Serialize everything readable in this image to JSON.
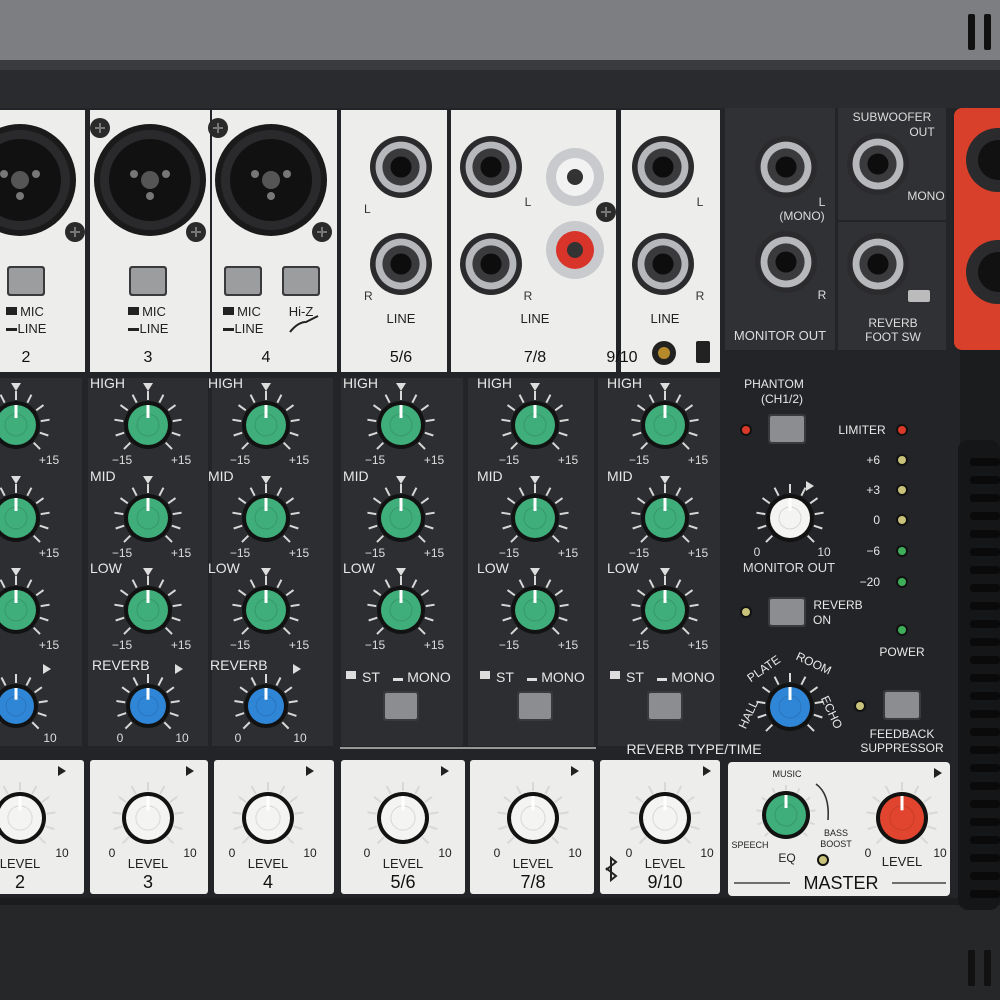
{
  "channels": [
    {
      "id": "ch2",
      "number": "2",
      "input": "combo",
      "switches": [
        "MIC",
        "LINE"
      ],
      "has_hiz": false,
      "reverb_label": "REVERB",
      "scale_min": "0",
      "scale_max": "10"
    },
    {
      "id": "ch3",
      "number": "3",
      "input": "combo",
      "switches": [
        "MIC",
        "LINE"
      ],
      "has_hiz": false,
      "reverb_label": "REVERB",
      "scale_min": "0",
      "scale_max": "10"
    },
    {
      "id": "ch4",
      "number": "4",
      "input": "combo",
      "switches": [
        "MIC",
        "LINE"
      ],
      "has_hiz": true,
      "hiz_label": "Hi-Z",
      "reverb_label": "REVERB",
      "scale_min": "0",
      "scale_max": "10"
    },
    {
      "id": "ch56",
      "number": "5/6",
      "input": "stereo-jack",
      "jack_labels": [
        "L",
        "R"
      ],
      "input_label": "LINE",
      "select": [
        "ST",
        "MONO"
      ]
    },
    {
      "id": "ch78",
      "number": "7/8",
      "input": "stereo-jack-rca",
      "jack_labels": [
        "L",
        "R"
      ],
      "input_label": "LINE",
      "select": [
        "ST",
        "MONO"
      ]
    },
    {
      "id": "ch910",
      "number": "9/10",
      "input": "stereo-jack-mini",
      "jack_labels": [
        "L",
        "R"
      ],
      "input_label": "LINE",
      "select": [
        "ST",
        "MONO"
      ]
    }
  ],
  "eq": {
    "bands": [
      "HIGH",
      "MID",
      "LOW"
    ],
    "scale_min": "−15",
    "scale_max": "+15"
  },
  "level": {
    "label": "LEVEL",
    "scale_min": "0",
    "scale_max": "10"
  },
  "master_section": {
    "monitor_out_label": "MONITOR OUT",
    "mono_label": "(MONO)",
    "jack_l": "L",
    "jack_r": "R",
    "subwoofer_label_line1": "SUBWOOFER",
    "subwoofer_label_line2": "OUT",
    "subwoofer_mono": "MONO",
    "reverb_foot_label_line1": "REVERB",
    "reverb_foot_label_line2": "FOOT SW",
    "phantom_label": "PHANTOM",
    "phantom_sub": "(CH1/2)",
    "monitor_knob_label": "MONITOR OUT",
    "monitor_scale_min": "0",
    "monitor_scale_max": "10",
    "reverb_on_line1": "REVERB",
    "reverb_on_line2": "ON",
    "limiter_label": "LIMITER",
    "meter_marks": [
      "+6",
      "+3",
      "0",
      "−6",
      "−20"
    ],
    "power_label": "POWER",
    "reverb_types": [
      "HALL",
      "PLATE",
      "ROOM",
      "ECHO"
    ],
    "reverb_type_label": "REVERB TYPE/TIME",
    "feedback_line1": "FEEDBACK",
    "feedback_line2": "SUPPRESSOR",
    "eq_label": "EQ",
    "eq_modes": [
      "MUSIC",
      "SPEECH",
      "BASS",
      "BOOST"
    ],
    "master_label": "MASTER"
  },
  "colors": {
    "panel": "#232427",
    "strip_light": "#ededeb",
    "knob_green": "#3fae7a",
    "knob_blue": "#2f86d6",
    "knob_white": "#f4f4f2",
    "knob_red": "#e2452f",
    "speaker_red": "#d8402c",
    "led_red": "#d93a2a",
    "led_green": "#3fae5a",
    "led_yellow": "#c9c27a"
  }
}
